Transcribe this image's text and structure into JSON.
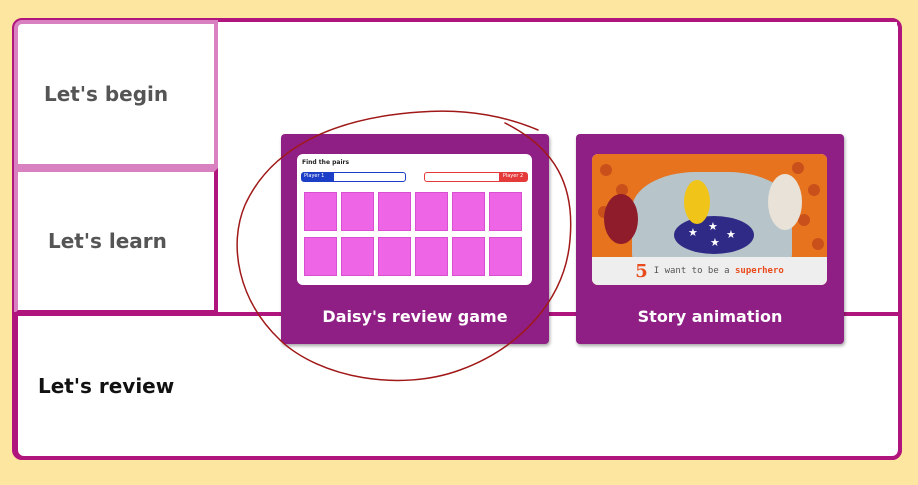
{
  "nav": {
    "begin_label": "Let's begin",
    "learn_label": "Let's learn",
    "review_label": "Let's review"
  },
  "cards": {
    "game": {
      "label": "Daisy's review game",
      "thumb_title": "Find the pairs",
      "player1": "Player 1",
      "player2": "Player 2"
    },
    "story": {
      "label": "Story animation",
      "thumb_number": "5",
      "thumb_title_prefix": "I want to be a ",
      "thumb_title_highlight": "superhero"
    }
  },
  "colors": {
    "background": "#fde7a0",
    "frame": "#b0157e",
    "card": "#8f1f84",
    "tile": "#ee66e6",
    "annotation": "#a01818"
  },
  "annotation": {
    "shape": "hand-drawn-circle",
    "target": "game-card"
  }
}
